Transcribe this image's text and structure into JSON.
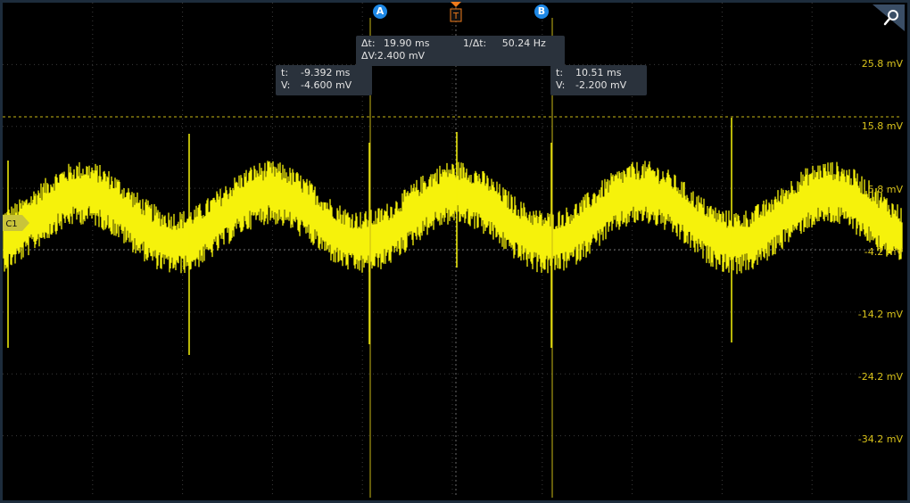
{
  "colors": {
    "background": "#000000",
    "trace": "#f6f20b",
    "grid": "#3b3b3b",
    "cursor_line": "#c8b816",
    "trigger": "#f07b1c",
    "cursor_marker": "#1e88e5",
    "readout_bg": "#2a323c",
    "channel_tag": "#c9c43a"
  },
  "icons": {
    "zoom": "magnifier-icon",
    "trigger": "trigger-t-marker",
    "channel": "channel-tag-arrow"
  },
  "cursors": {
    "a": {
      "marker": "A"
    },
    "b": {
      "marker": "B"
    },
    "trigger_label": "T"
  },
  "readouts": {
    "delta": {
      "dt_label": "Δt:",
      "dt_value": "19.90 ms",
      "inv_label": "1/Δt:",
      "inv_value": "50.24 Hz",
      "dv_label": "ΔV:",
      "dv_value": "2.400 mV"
    },
    "a": {
      "t_label": "t:",
      "t_value": "-9.392 ms",
      "v_label": "V:",
      "v_value": "-4.600 mV"
    },
    "b": {
      "t_label": "t:",
      "t_value": "10.51 ms",
      "v_label": "V:",
      "v_value": "-2.200 mV"
    }
  },
  "channel": {
    "label": "C1"
  },
  "vertical_labels": [
    "25.8 mV",
    "15.8 mV",
    "5.8 mV",
    "-4.2 mV",
    "-14.2 mV",
    "-24.2 mV",
    "-34.2 mV"
  ]
}
